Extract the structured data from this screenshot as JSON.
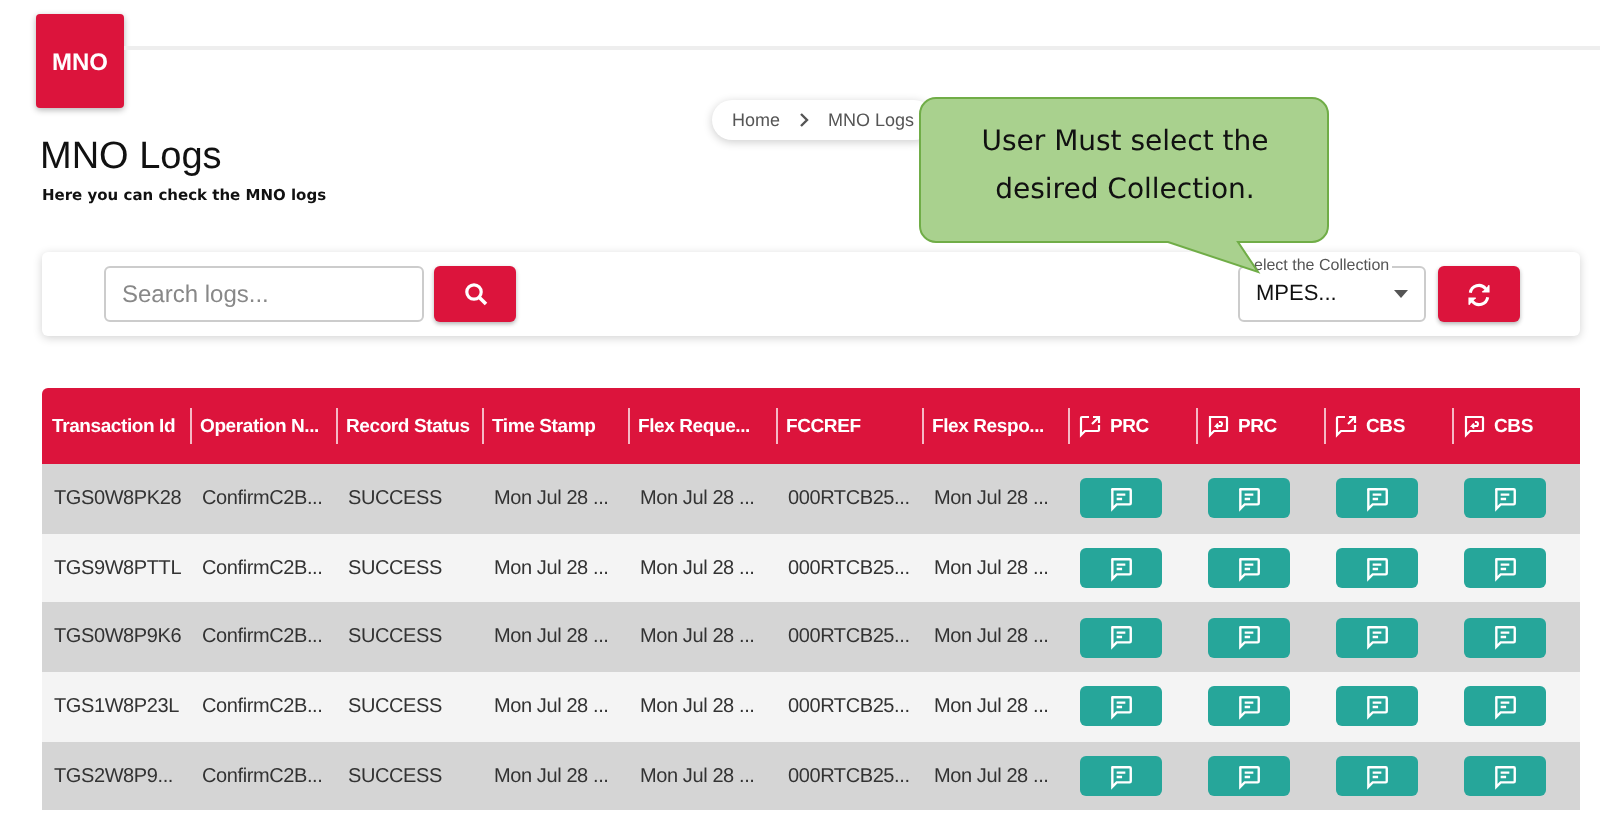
{
  "logo": {
    "text": "MNO"
  },
  "breadcrumb": [
    {
      "label": "Home"
    },
    {
      "label": "MNO Logs"
    }
  ],
  "page": {
    "title": "MNO Logs",
    "subtitle": "Here you can check the MNO logs"
  },
  "callout": {
    "lines": [
      "User Must select the",
      "desired Collection."
    ]
  },
  "toolbar": {
    "search": {
      "placeholder": "Search logs..."
    },
    "collection": {
      "label": "elect the Collection",
      "value": "MPES..."
    }
  },
  "table": {
    "columns": [
      {
        "label": "Transaction Id",
        "kind": "text"
      },
      {
        "label": "Operation N...",
        "kind": "text"
      },
      {
        "label": "Record Status",
        "kind": "text"
      },
      {
        "label": "Time Stamp",
        "kind": "text"
      },
      {
        "label": "Flex Reque...",
        "kind": "text"
      },
      {
        "label": "FCCREF",
        "kind": "text"
      },
      {
        "label": "Flex Respo...",
        "kind": "text"
      },
      {
        "label": "PRC",
        "kind": "outgoing"
      },
      {
        "label": "PRC",
        "kind": "incoming"
      },
      {
        "label": "CBS",
        "kind": "outgoing"
      },
      {
        "label": "CBS",
        "kind": "incoming"
      }
    ],
    "rows": [
      {
        "cells": [
          "TGS0W8PK28",
          "ConfirmC2B...",
          "SUCCESS",
          "Mon Jul 28 ...",
          "Mon Jul 28 ...",
          "000RTCB25...",
          "Mon Jul 28 ..."
        ]
      },
      {
        "cells": [
          "TGS9W8PTTL",
          "ConfirmC2B...",
          "SUCCESS",
          "Mon Jul 28 ...",
          "Mon Jul 28 ...",
          "000RTCB25...",
          "Mon Jul 28 ..."
        ]
      },
      {
        "cells": [
          "TGS0W8P9K6",
          "ConfirmC2B...",
          "SUCCESS",
          "Mon Jul 28 ...",
          "Mon Jul 28 ...",
          "000RTCB25...",
          "Mon Jul 28 ..."
        ]
      },
      {
        "cells": [
          "TGS1W8P23L",
          "ConfirmC2B...",
          "SUCCESS",
          "Mon Jul 28 ...",
          "Mon Jul 28 ...",
          "000RTCB25...",
          "Mon Jul 28 ..."
        ]
      },
      {
        "cells": [
          "TGS2W8P9...",
          "ConfirmC2B...",
          "SUCCESS",
          "Mon Jul 28 ...",
          "Mon Jul 28 ...",
          "000RTCB25...",
          "Mon Jul 28 ..."
        ]
      }
    ]
  }
}
